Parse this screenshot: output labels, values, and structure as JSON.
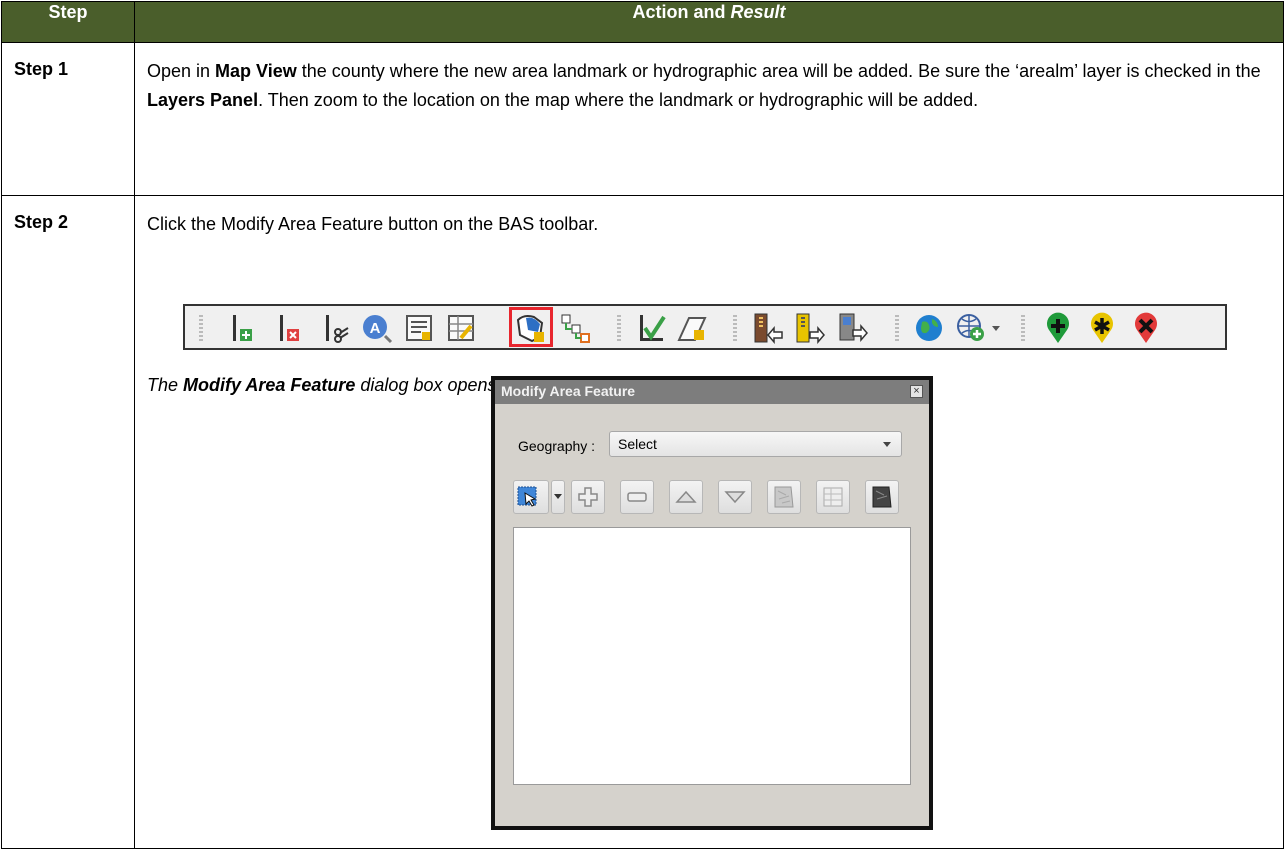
{
  "header": {
    "step": "Step",
    "action_prefix": "Action and ",
    "action_italic": "Result"
  },
  "rows": [
    {
      "step": "Step 1",
      "segments": [
        {
          "t": "Open in "
        },
        {
          "t": "Map View",
          "b": true
        },
        {
          "t": " the county where the new area landmark or hydrographic area will be added. Be sure the ‘arealm’ layer is checked in the "
        },
        {
          "t": "Layers Panel",
          "b": true
        },
        {
          "t": ". Then zoom to the location on the map where the landmark or hydrographic will be added."
        }
      ]
    },
    {
      "step": "Step 2",
      "text": "Click the Modify Area Feature button on the BAS toolbar."
    }
  ],
  "toolbar": {
    "icons": [
      "add-line-icon",
      "delete-line-icon",
      "split-line-icon",
      "label-search-icon",
      "attribute-form-icon",
      "edit-table-icon",
      "modify-area-feature-icon",
      "topology-icon",
      "validate-icon",
      "new-area-icon",
      "export-icon",
      "import-icon",
      "map-export-icon",
      "globe-icon",
      "add-web-layer-icon",
      "add-point-marker-icon",
      "star-marker-icon",
      "delete-marker-icon"
    ],
    "highlighted": "modify-area-feature-icon",
    "highlight_color": "#e8262e"
  },
  "note": {
    "bold": "Modify Area Feature",
    "rest": " dialog box opens.",
    "prefix": "The "
  },
  "dialog": {
    "title": "Modify Area Feature",
    "close": "×",
    "geography_label": "Geography :",
    "geography_value": "Select",
    "buttons": [
      "select-tool-icon",
      "add-icon",
      "remove-icon",
      "move-up-icon",
      "move-down-icon",
      "map-view-icon",
      "table-view-icon",
      "dark-map-icon"
    ]
  },
  "colors": {
    "header_bg": "#4a5e2b",
    "dialog_bg": "#d5d2cc",
    "titlebar": "#7d7d7d"
  }
}
